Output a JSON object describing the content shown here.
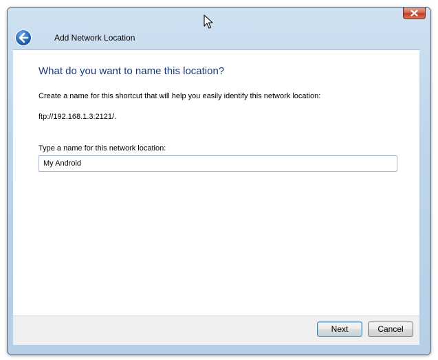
{
  "window": {
    "title": "Add Network Location",
    "close_icon": "close-x-icon",
    "back_icon": "back-arrow-icon"
  },
  "page": {
    "heading": "What do you want to name this location?",
    "description": "Create a name for this shortcut that will help you easily identify this network location:",
    "address": "ftp://192.168.1.3:2121/.",
    "field_label": "Type a name for this network location:",
    "name_value": "My Android"
  },
  "footer": {
    "next_label": "Next",
    "cancel_label": "Cancel"
  },
  "colors": {
    "heading": "#17377a",
    "close_button": "#c13b26",
    "back_button": "#2d6fc0"
  }
}
